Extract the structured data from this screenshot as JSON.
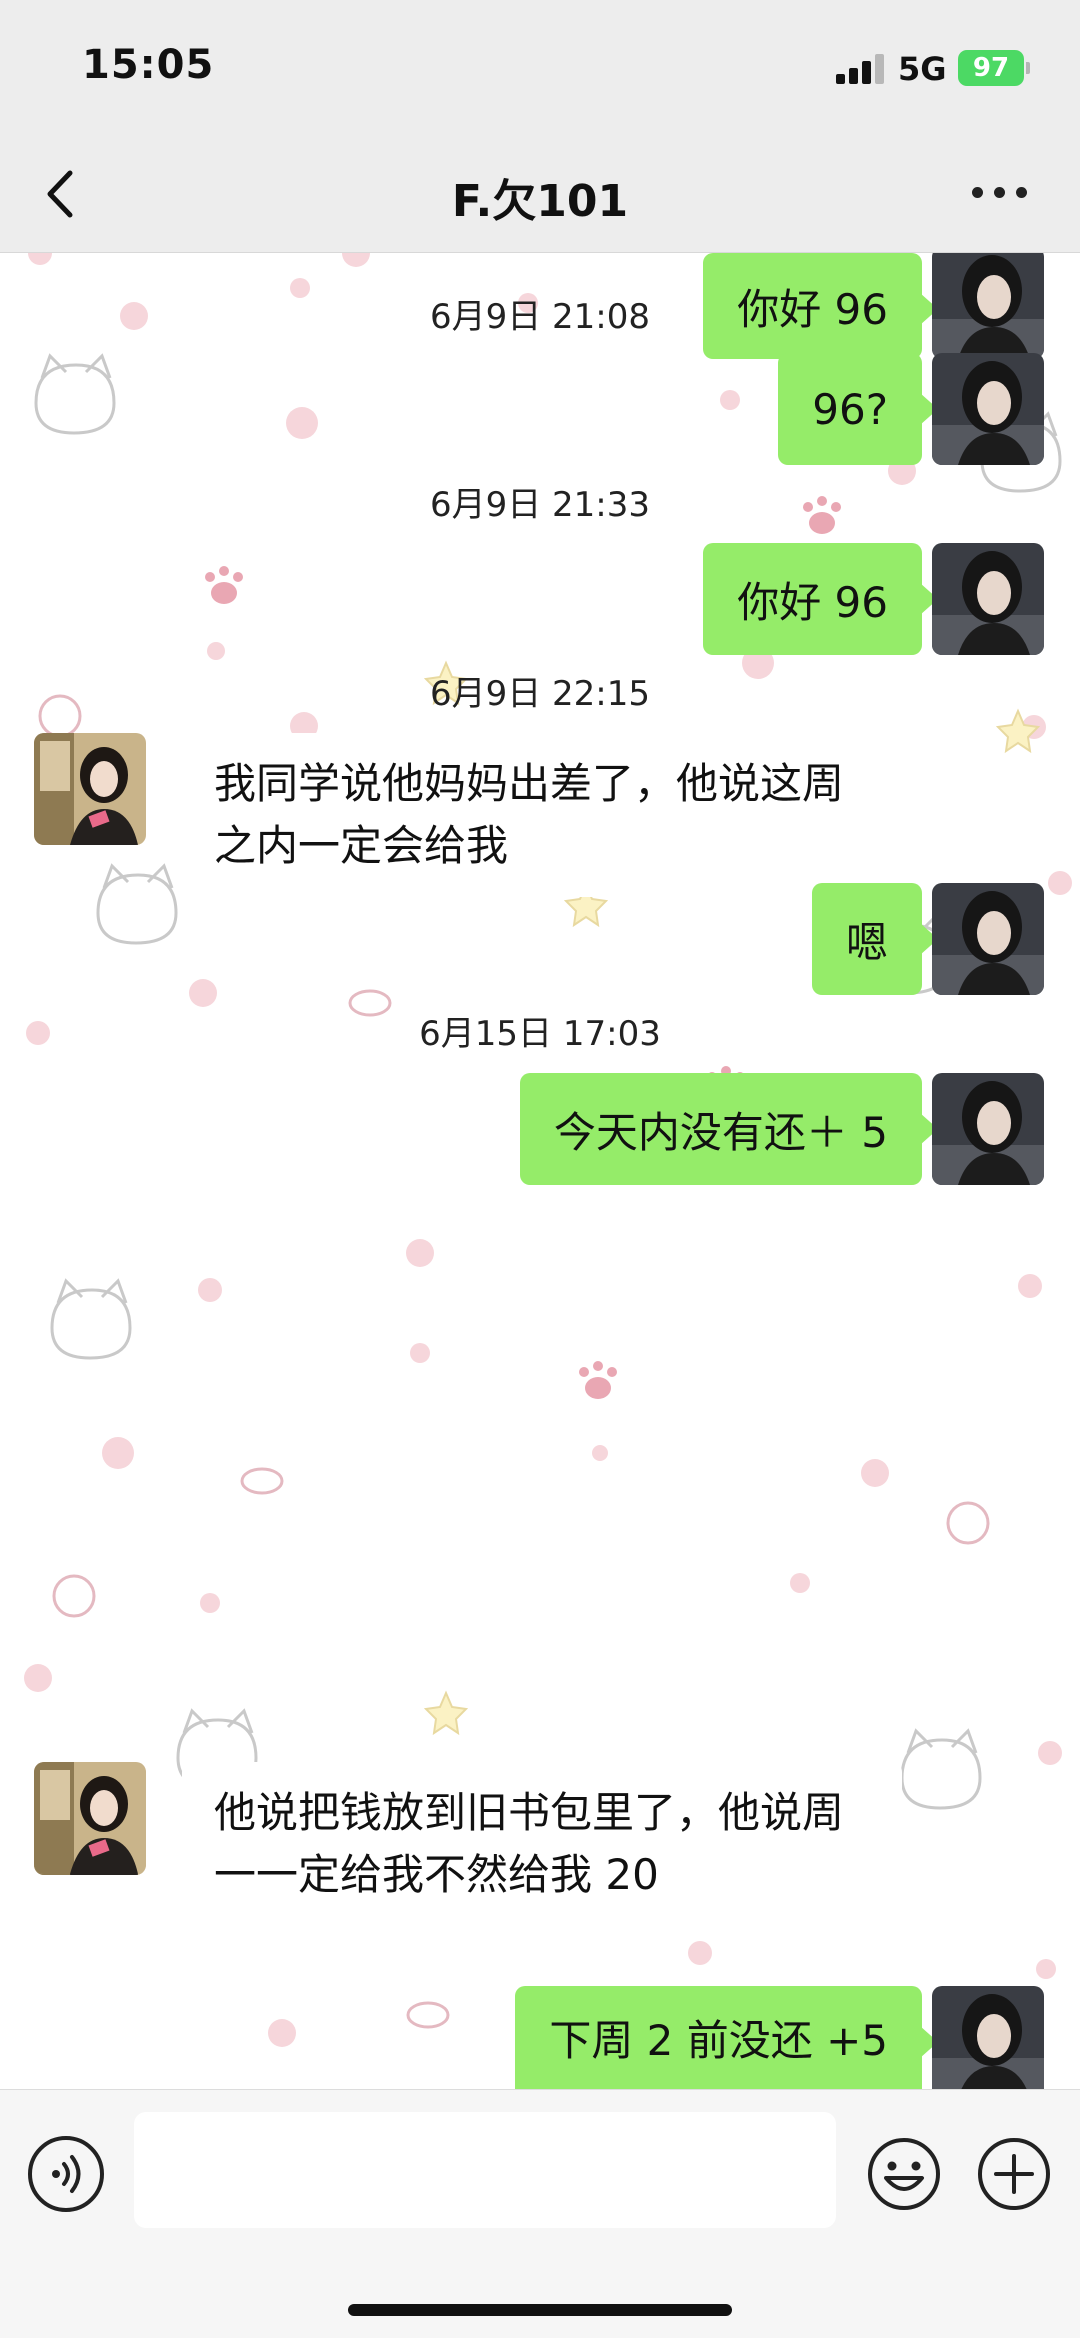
{
  "status_bar": {
    "time": "15:05",
    "network": "5G",
    "battery": "97"
  },
  "nav": {
    "title": "F.欠101",
    "back_icon": "chevron-left-icon",
    "more_icon": "ellipsis-icon"
  },
  "messages": [
    {
      "type": "out",
      "text": "你好 96"
    },
    {
      "type": "time",
      "text": "6月9日 21:08"
    },
    {
      "type": "out",
      "text": "96?"
    },
    {
      "type": "time",
      "text": "6月9日 21:33"
    },
    {
      "type": "out",
      "text": "你好 96"
    },
    {
      "type": "time",
      "text": "6月9日 22:15"
    },
    {
      "type": "in",
      "text": "我同学说他妈妈出差了，他说这周之内一定会给我"
    },
    {
      "type": "out",
      "text": "嗯"
    },
    {
      "type": "time",
      "text": "6月15日 17:03"
    },
    {
      "type": "out",
      "text": "今天内没有还＋ 5"
    },
    {
      "type": "in",
      "text": "他说把钱放到旧书包里了，他说周一一定给我不然给我 20"
    },
    {
      "type": "out",
      "text": "下周 2 前没还 +5"
    }
  ],
  "input_bar": {
    "voice_icon": "voice-icon",
    "emoji_icon": "emoji-icon",
    "plus_icon": "plus-icon",
    "input_value": ""
  },
  "colors": {
    "outgoing_bubble": "#95ec69",
    "incoming_bubble": "#ffffff",
    "battery": "#4cd964",
    "bar_background": "#ededed"
  }
}
